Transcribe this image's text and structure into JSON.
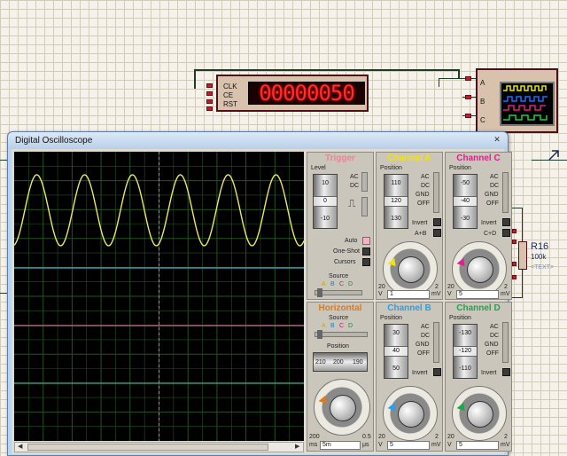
{
  "schematic": {
    "counter": {
      "pins": [
        "CLK",
        "CE",
        "RST"
      ],
      "display": "00000050",
      "display_color": "#ff2d2d"
    },
    "scope_block": {
      "inputs": [
        "A",
        "B",
        "C"
      ]
    },
    "resistor": {
      "name": "R16",
      "value": "100k",
      "text": "<TEXT>"
    }
  },
  "window": {
    "title": "Digital Oscilloscope",
    "close_icon": "close-icon"
  },
  "trigger": {
    "title": "Trigger",
    "title_color": "#e08a9a",
    "level_label": "Level",
    "wheel_values": [
      "10",
      "0",
      "-10"
    ],
    "coupling": [
      "AC",
      "DC"
    ],
    "modes": [
      "Auto",
      "One-Shot",
      "Cursors"
    ],
    "source_label": "Source",
    "source_options": [
      "A",
      "B",
      "C",
      "D"
    ]
  },
  "channel_a": {
    "title": "Channel A",
    "title_color": "#f5e300",
    "position_label": "Position",
    "wheel_values": [
      "110",
      "120",
      "130"
    ],
    "coupling": [
      "AC",
      "DC",
      "GND",
      "OFF"
    ],
    "invert_label": "Invert",
    "combine_label": "A+B",
    "scale_left": "20",
    "scale_right": "2",
    "unit_left": "V",
    "volts_div": "1",
    "unit_right": "mV"
  },
  "channel_c": {
    "title": "Channel C",
    "title_color": "#e0208c",
    "position_label": "Position",
    "wheel_values": [
      "-50",
      "-40",
      "-30"
    ],
    "coupling": [
      "AC",
      "DC",
      "GND",
      "OFF"
    ],
    "invert_label": "Invert",
    "combine_label": "C+D",
    "scale_left": "20",
    "scale_right": "2",
    "unit_left": "V",
    "volts_div": "5",
    "unit_right": "mV"
  },
  "horizontal": {
    "title": "Horizontal",
    "title_color": "#e07a1a",
    "source_label": "Source",
    "source_options": [
      "A",
      "B",
      "C",
      "D"
    ],
    "position_label": "Position",
    "ruler_values": [
      "210",
      "200",
      "190"
    ],
    "scale_left": "200",
    "scale_right": "0.5",
    "unit_left": "ms",
    "time_div": "5m",
    "unit_right": "μs"
  },
  "channel_b": {
    "title": "Channel B",
    "title_color": "#2aa0e8",
    "position_label": "Position",
    "wheel_values": [
      "30",
      "40",
      "50"
    ],
    "coupling": [
      "AC",
      "DC",
      "GND",
      "OFF"
    ],
    "invert_label": "Invert",
    "scale_left": "20",
    "scale_right": "2",
    "unit_left": "V",
    "volts_div": "5",
    "unit_right": "mV"
  },
  "channel_d": {
    "title": "Channel D",
    "title_color": "#1aa84a",
    "position_label": "Position",
    "wheel_values": [
      "-130",
      "-120",
      "-110"
    ],
    "coupling": [
      "AC",
      "DC",
      "GND",
      "OFF"
    ],
    "invert_label": "Invert",
    "scale_left": "20",
    "scale_right": "2",
    "unit_left": "V",
    "volts_div": "5",
    "unit_right": "mV"
  },
  "screen": {
    "trace_colors": {
      "A": "#e8e86a",
      "B": "#46a9c4",
      "C": "#c86a8e",
      "D": "#3fae7e"
    }
  }
}
